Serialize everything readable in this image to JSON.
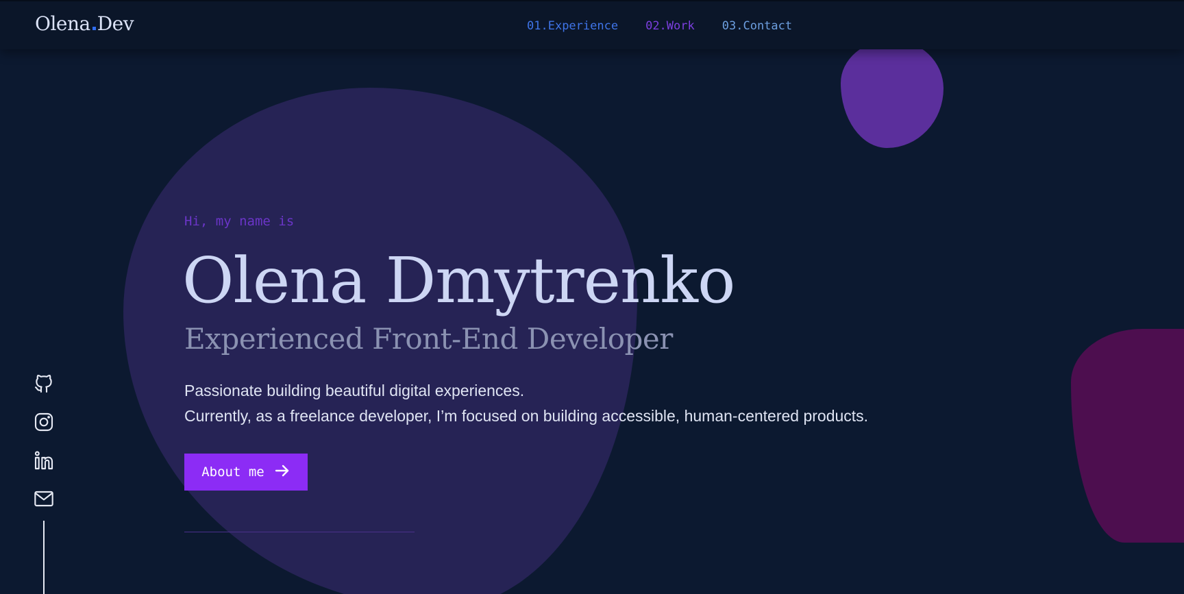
{
  "brand": {
    "logo_first": "Olena",
    "logo_second": "Dev",
    "accent": "#2f6df0"
  },
  "nav": {
    "items": [
      {
        "num": "01.",
        "label": "Experience",
        "color": "#3f74e8"
      },
      {
        "num": "02.",
        "label": "Work",
        "color": "#7c3fe0"
      },
      {
        "num": "03.",
        "label": "Contact",
        "color": "#6d9fe0"
      }
    ]
  },
  "hero": {
    "greeting": "Hi, my name is",
    "name": "Olena Dmytrenko",
    "role": "Experienced Front-End Developer",
    "desc_line1": "Passionate building beautiful digital experiences.",
    "desc_line2": "Currently, as a freelance developer, I’m focused on building accessible, human-centered products.",
    "cta_label": "About me",
    "cta_icon": "arrow-right-icon",
    "cta_color": "#8c2cf5"
  },
  "social": {
    "icons": [
      "github-icon",
      "instagram-icon",
      "linkedin-icon",
      "mail-icon"
    ]
  },
  "colors": {
    "background": "#0c1930",
    "header": "#0b1629",
    "blob_big": "#262355",
    "blob_small": "#5b2f9c",
    "blob_right": "#4d0e4f"
  }
}
